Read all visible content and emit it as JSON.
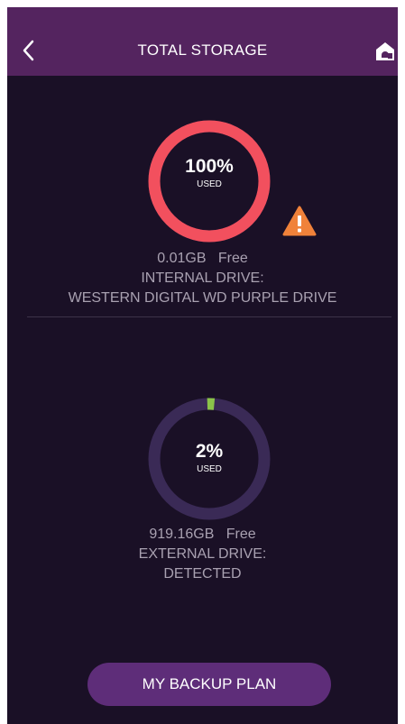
{
  "header": {
    "title": "TOTAL STORAGE",
    "back_icon": "chevron-left-icon",
    "home_icon": "home-icon"
  },
  "internal": {
    "percent_label": "100%",
    "used_label": "USED",
    "percent_value": 100,
    "ring_color": "#f2505e",
    "free_amount": "0.01GB",
    "free_label": "Free",
    "drive_label": "INTERNAL DRIVE:",
    "drive_name": "WESTERN DIGITAL WD PURPLE DRIVE",
    "warning_icon": "warning-triangle-icon",
    "warning_color": "#f0823a"
  },
  "external": {
    "percent_label": "2%",
    "used_label": "USED",
    "percent_value": 2,
    "ring_color": "#8bc34a",
    "track_color": "#3a2a56",
    "free_amount": "919.16GB",
    "free_label": "Free",
    "drive_label": "EXTERNAL DRIVE:",
    "drive_status": "DETECTED"
  },
  "footer": {
    "backup_button": "MY BACKUP PLAN"
  }
}
